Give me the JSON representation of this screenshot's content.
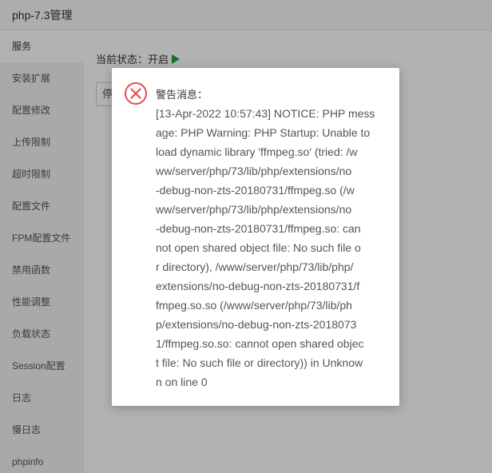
{
  "window": {
    "title": "php-7.3管理"
  },
  "sidebar": {
    "items": [
      {
        "label": "服务"
      },
      {
        "label": "安装扩展"
      },
      {
        "label": "配置修改"
      },
      {
        "label": "上传限制"
      },
      {
        "label": "超时限制"
      },
      {
        "label": "配置文件"
      },
      {
        "label": "FPM配置文件"
      },
      {
        "label": "禁用函数"
      },
      {
        "label": "性能调整"
      },
      {
        "label": "负载状态"
      },
      {
        "label": "Session配置"
      },
      {
        "label": "日志"
      },
      {
        "label": "慢日志"
      },
      {
        "label": "phpinfo"
      }
    ]
  },
  "service": {
    "status_label": "当前状态：",
    "status_value": "开启",
    "stop_button_label": "停止"
  },
  "dialog": {
    "heading": "警告消息：",
    "lines": [
      "[13-Apr-2022 10:57:43] NOTICE: PHP mess",
      "age: PHP Warning: PHP Startup: Unable to",
      "load dynamic library 'ffmpeg.so' (tried: /w",
      "ww/server/php/73/lib/php/extensions/no",
      "-debug-non-zts-20180731/ffmpeg.so (/w",
      "ww/server/php/73/lib/php/extensions/no",
      "-debug-non-zts-20180731/ffmpeg.so: can",
      "not open shared object file: No such file o",
      "r directory), /www/server/php/73/lib/php/",
      "extensions/no-debug-non-zts-20180731/f",
      "fmpeg.so.so (/www/server/php/73/lib/ph",
      "p/extensions/no-debug-non-zts-2018073",
      "1/ffmpeg.so.so: cannot open shared objec",
      "t file: No such file or directory)) in Unknow",
      "n on line 0"
    ]
  },
  "colors": {
    "accent_green": "#20a53a",
    "error_red": "#e64c4c",
    "overlay": "rgba(0,0,0,0.3)"
  },
  "icons": {
    "status": "play-icon",
    "dialog": "error-circle-icon"
  }
}
